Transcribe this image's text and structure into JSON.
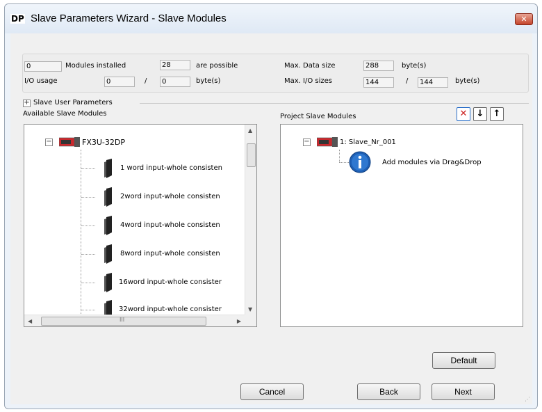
{
  "window": {
    "icon_text": "DP",
    "title": "Slave Parameters Wizard - Slave Modules",
    "close_icon": "close-icon"
  },
  "info": {
    "modules_installed_value": "0",
    "modules_installed_label": "Modules installed",
    "possible_value": "28",
    "possible_label": "are possible",
    "max_data_size_label": "Max. Data size",
    "max_data_size_value": "288",
    "max_data_size_unit": "byte(s)",
    "io_usage_label": "I/O usage",
    "io_usage_in": "0",
    "io_usage_sep": "/",
    "io_usage_out": "0",
    "io_usage_unit": "byte(s)",
    "max_io_label": "Max. I/O sizes",
    "max_io_in": "144",
    "max_io_sep": "/",
    "max_io_out": "144",
    "max_io_unit": "byte(s)"
  },
  "user_params": {
    "expander": "+",
    "label": "Slave User Parameters"
  },
  "available": {
    "heading": "Available Slave Modules",
    "root_expander": "−",
    "root_label": "FX3U-32DP",
    "items": [
      "1 word input-whole consisten",
      "2word input-whole consisten",
      "4word input-whole consisten",
      "8word input-whole consisten",
      "16word input-whole consister",
      "32word input-whole consister"
    ],
    "hscroll_mark": "III"
  },
  "project": {
    "heading": "Project Slave Modules",
    "root_expander": "−",
    "root_label": "1: Slave_Nr_001",
    "info_text": "Add modules via Drag&Drop",
    "toolbar": {
      "delete_icon": "✕",
      "down_icon": "↓",
      "up_icon": "↑"
    }
  },
  "buttons": {
    "default": "Default",
    "cancel": "Cancel",
    "back": "Back",
    "next": "Next"
  },
  "colors": {
    "delete_red": "#cc2222",
    "info_blue": "#1e5fb4"
  }
}
